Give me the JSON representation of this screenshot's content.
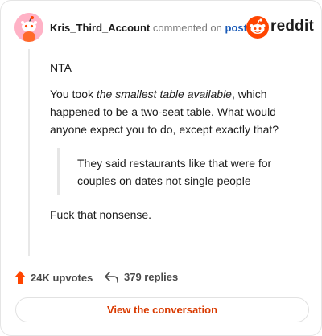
{
  "header": {
    "username": "Kris_Third_Account",
    "commented_on": "commented on",
    "post_link": "post",
    "logo_text": "reddit"
  },
  "comment": {
    "line1": "NTA",
    "para2_before": "You took ",
    "para2_emphasis": "the smallest table available",
    "para2_after": ", which happened to be a two-seat table. What would anyone expect you to do, except exactly that?",
    "quote": "They said restaurants like that were for couples on dates not single people",
    "line4": "Fuck that nonsense."
  },
  "footer": {
    "upvotes": "24K upvotes",
    "replies": "379 replies"
  },
  "cta": {
    "label": "View the conversation"
  },
  "colors": {
    "brand": "#ff4500",
    "link": "#1a5bb8",
    "cta_text": "#d93a00",
    "avatar_bg": "#ffb2c6"
  },
  "icons": {
    "avatar": "reddit-snoo-avatar",
    "logo": "reddit-logo",
    "upvote": "upvote-arrow-icon",
    "replies": "reply-arrow-icon"
  }
}
